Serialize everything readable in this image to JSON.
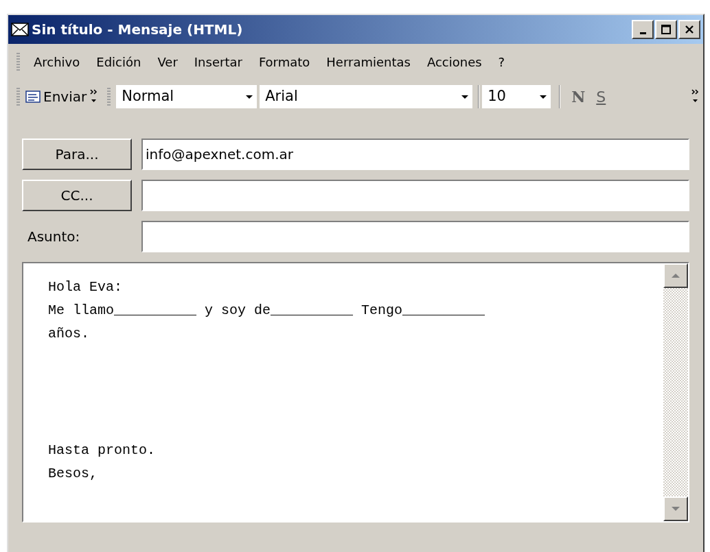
{
  "window": {
    "title": "Sin título - Mensaje (HTML)"
  },
  "menu": [
    "Archivo",
    "Edición",
    "Ver",
    "Insertar",
    "Formato",
    "Herramientas",
    "Acciones",
    "?"
  ],
  "toolbar": {
    "send": "Enviar",
    "style": "Normal",
    "font": "Arial",
    "size": "10",
    "bold": "N",
    "underline": "S"
  },
  "fields": [
    {
      "kind": "button",
      "label": "Para...",
      "value": "info@apexnet.com.ar"
    },
    {
      "kind": "button",
      "label": "CC..."
    },
    {
      "kind": "label",
      "label": "Asunto:"
    }
  ],
  "body": {
    "paragraphs": [
      [
        "Hola Eva:",
        "Me llamo__________ y soy de__________ Tengo__________",
        "años."
      ],
      [
        "Hasta pronto.",
        "Besos,"
      ]
    ]
  }
}
